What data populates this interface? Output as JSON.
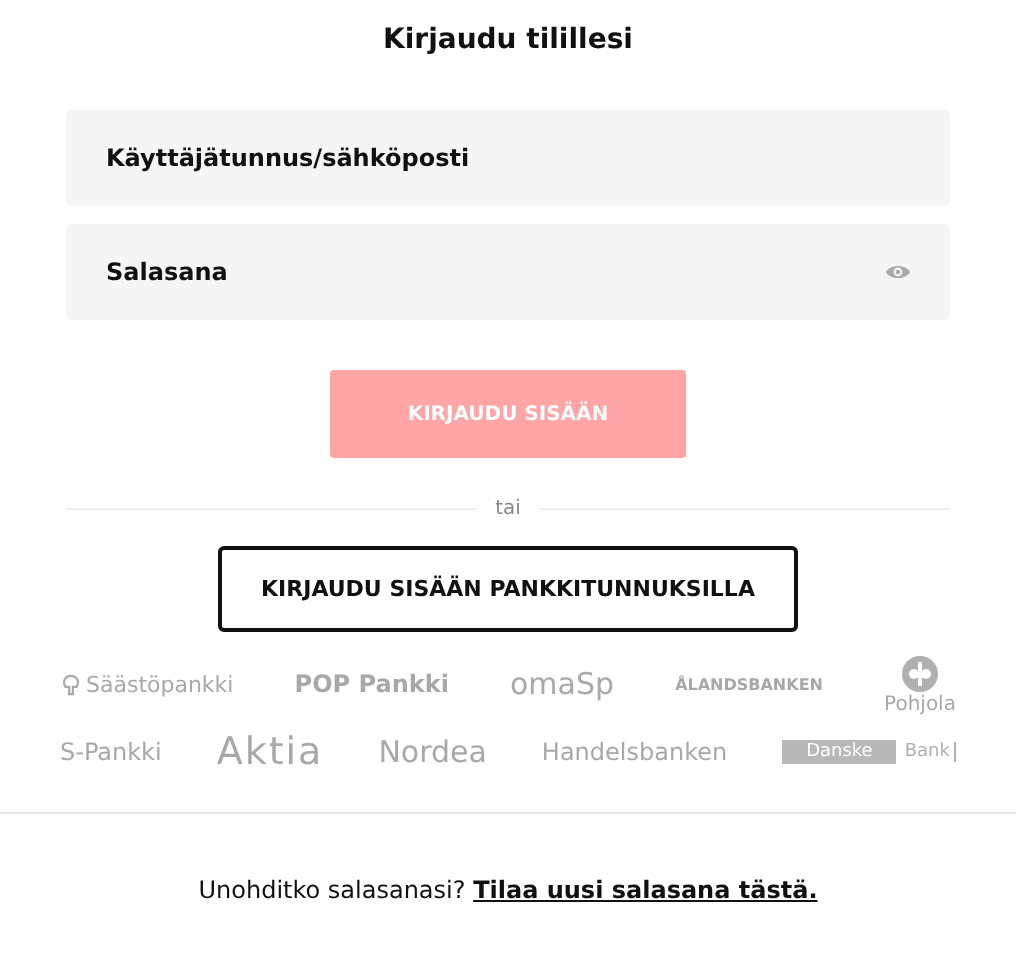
{
  "title": "Kirjaudu tilillesi",
  "fields": [
    {
      "kind": "text",
      "placeholder": "Käyttäjätunnus/sähköposti"
    },
    {
      "kind": "password",
      "placeholder": "Salasana"
    }
  ],
  "submit": {
    "label": "KIRJAUDU SISÄÄN",
    "disabled": true
  },
  "separator": "tai",
  "bank_button": "KIRJAUDU SISÄÄN PANKKITUNNUKSILLA",
  "bank_logos": [
    [
      {
        "kind": "leaf",
        "text": "Säästöpankki"
      },
      {
        "kind": "pop",
        "text": "POP Pankki"
      },
      {
        "kind": "light",
        "text": "omaSp"
      },
      {
        "kind": "caps",
        "text": "ÅLANDSBANKEN"
      },
      {
        "kind": "pohjola",
        "text": "Pohjola"
      }
    ],
    [
      {
        "kind": "plain",
        "text": "S-Pankki"
      },
      {
        "kind": "big",
        "text": "Aktia"
      },
      {
        "kind": "round",
        "text": "Nordea"
      },
      {
        "kind": "plain",
        "text": "Handelsbanken"
      },
      {
        "kind": "danske",
        "text": "Danske",
        "text2": "Bank"
      }
    ]
  ],
  "footer": {
    "question": "Unohditko salasanasi?",
    "link": "Tilaa uusi salasana tästä."
  }
}
